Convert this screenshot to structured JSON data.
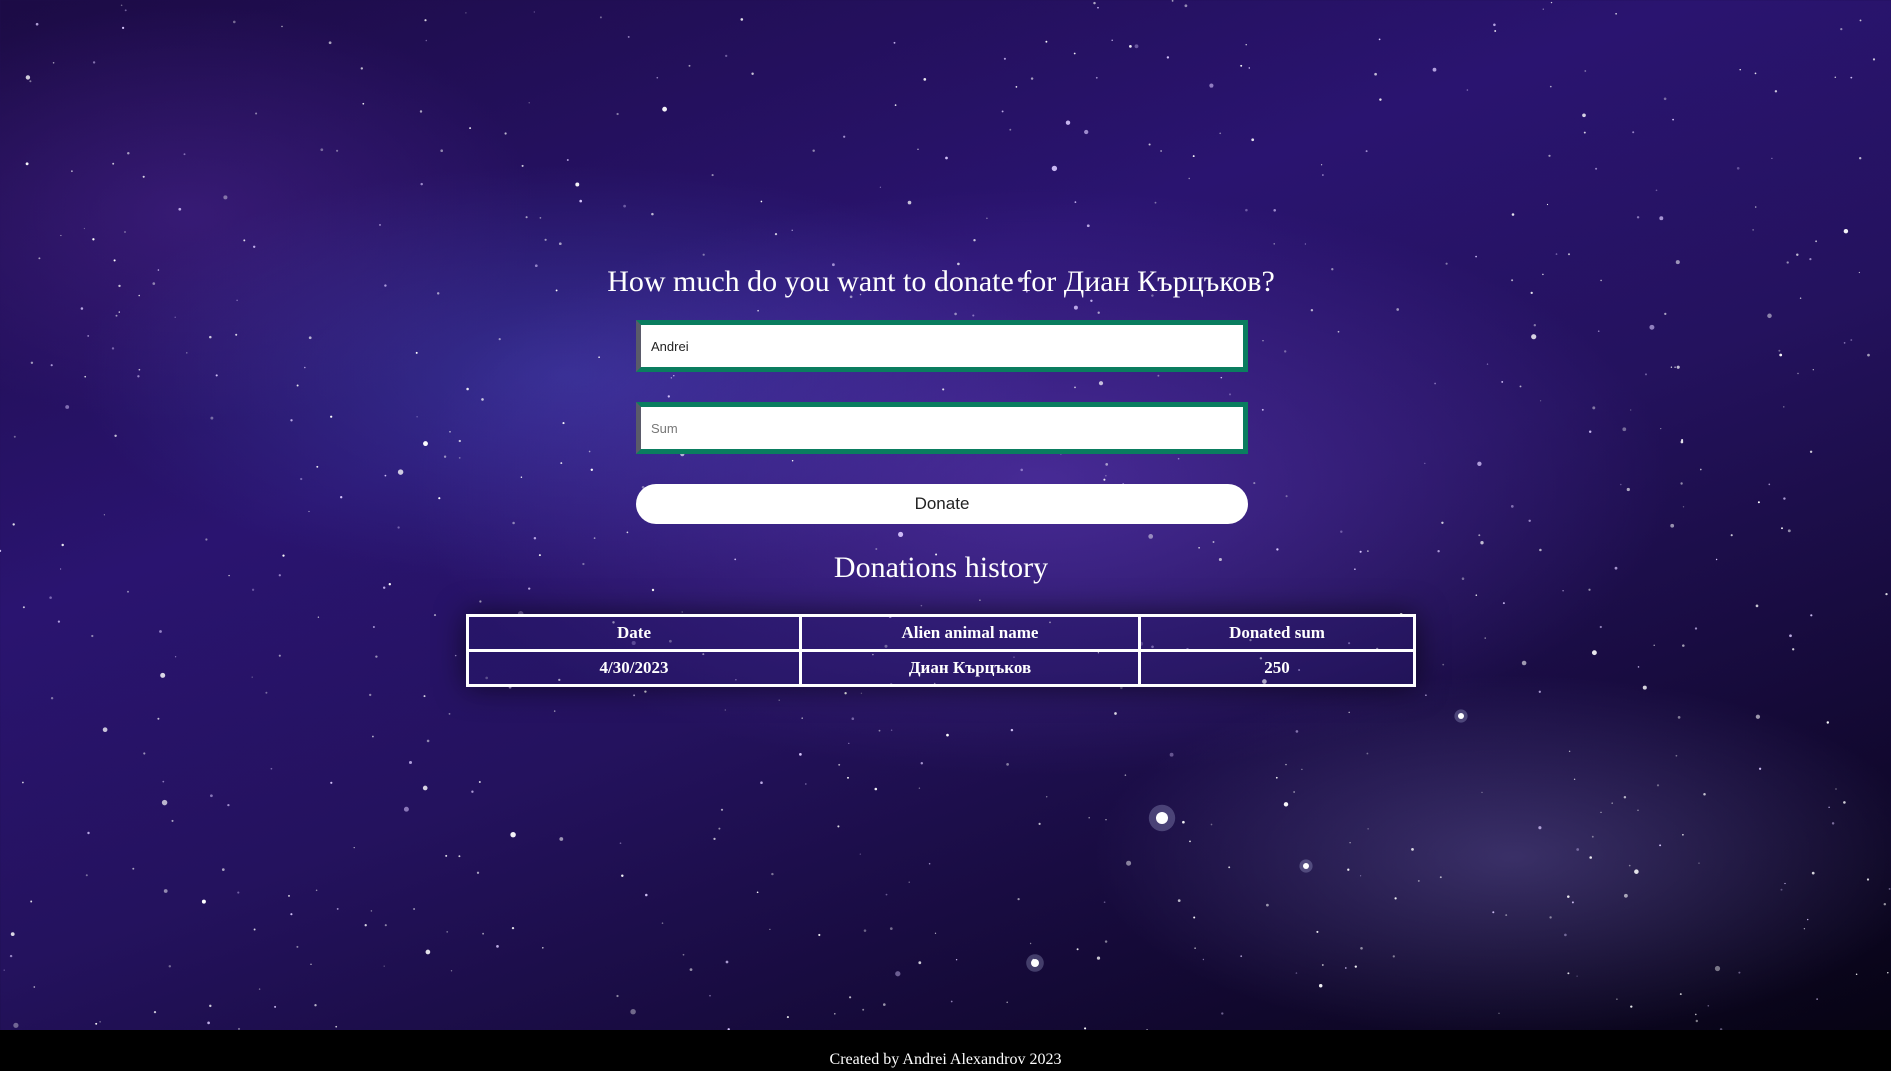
{
  "heading": "How much do you want to donate for Диан Кърцъков?",
  "form": {
    "name_value": "Andrei",
    "sum_placeholder": "Sum",
    "donate_label": "Donate"
  },
  "history": {
    "title": "Donations history",
    "columns": [
      "Date",
      "Alien animal name",
      "Donated sum"
    ],
    "rows": [
      [
        "4/30/2023",
        "Диан Кърцъков",
        "250"
      ]
    ]
  },
  "footer": "Created by Andrei Alexandrov 2023",
  "colors": {
    "field_border": "#0a7d5f",
    "footer_bg": "#000000"
  }
}
